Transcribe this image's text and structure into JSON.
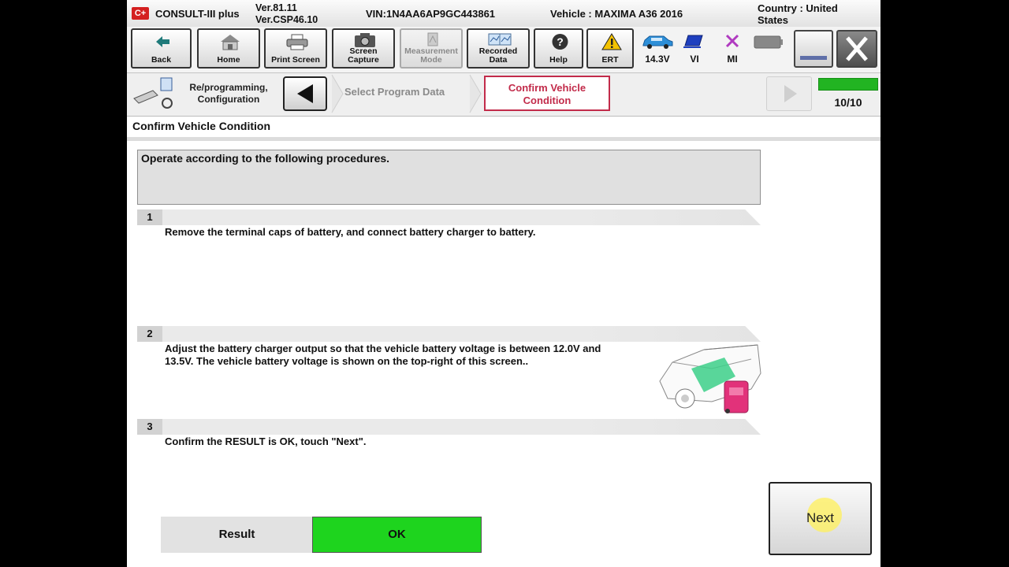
{
  "title_bar": {
    "logo": "C+",
    "app_name": "CONSULT-III plus",
    "version_1": "Ver.81.11",
    "version_2": "Ver.CSP46.10",
    "vin": "VIN:1N4AA6AP9GC443861",
    "vehicle": "Vehicle : MAXIMA A36 2016",
    "country_1": "Country : United",
    "country_2": "States"
  },
  "toolbar": {
    "back": "Back",
    "home": "Home",
    "print": "Print Screen",
    "capture_1": "Screen",
    "capture_2": "Capture",
    "measure_1": "Measurement",
    "measure_2": "Mode",
    "recorded_1": "Recorded",
    "recorded_2": "Data",
    "help": "Help",
    "ert": "ERT",
    "voltage": "14.3V",
    "vi": "VI",
    "mi": "MI"
  },
  "nav": {
    "reprog_1": "Re/programming,",
    "reprog_2": "Configuration",
    "step_select": "Select Program Data",
    "step_confirm_1": "Confirm Vehicle",
    "step_confirm_2": "Condition",
    "progress": "10/10",
    "progress_fraction": 1.0
  },
  "content": {
    "page_title": "Confirm Vehicle Condition",
    "instruction": "Operate according to the following procedures.",
    "steps": [
      {
        "num": "1",
        "text": "Remove the terminal caps of battery, and connect battery charger to battery."
      },
      {
        "num": "2",
        "text_1": "Adjust the battery charger output so that the vehicle battery voltage is between 12.0V and",
        "text_2": "13.5V. The vehicle battery voltage is shown on the top-right of this screen.."
      },
      {
        "num": "3",
        "text": "Confirm the RESULT is OK, touch \"Next\"."
      }
    ],
    "result_label": "Result",
    "result_value": "OK",
    "next": "Next"
  },
  "colors": {
    "ok_green": "#1ed41e",
    "active_step": "#c22b4a",
    "progress_green": "#22b422",
    "logo_red": "#d42020"
  },
  "icons": [
    "back-arrow-icon",
    "home-icon",
    "printer-icon",
    "camera-icon",
    "measurement-icon",
    "recorded-data-icon",
    "help-icon",
    "warning-icon",
    "car-battery-icon",
    "vi-icon",
    "mi-x-icon",
    "battery-icon",
    "minimize-icon",
    "close-icon",
    "reprogramming-icon",
    "nav-back-icon",
    "nav-forward-icon"
  ]
}
